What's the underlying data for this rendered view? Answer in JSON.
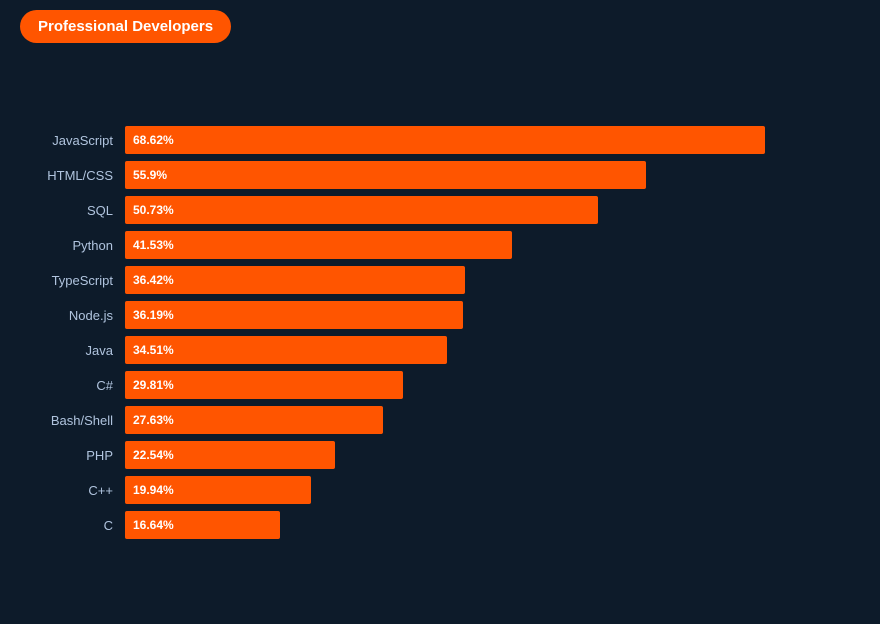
{
  "title": "Professional Developers",
  "colors": {
    "bg": "#0d1b2a",
    "bar": "#ff5500",
    "label": "#b0c4de",
    "text": "#ffffff",
    "badge_bg": "#ff5500"
  },
  "chart": {
    "max_percent": 68.62,
    "track_width": 640,
    "bars": [
      {
        "label": "JavaScript",
        "value": 68.62,
        "display": "68.62%"
      },
      {
        "label": "HTML/CSS",
        "value": 55.9,
        "display": "55.9%"
      },
      {
        "label": "SQL",
        "value": 50.73,
        "display": "50.73%"
      },
      {
        "label": "Python",
        "value": 41.53,
        "display": "41.53%"
      },
      {
        "label": "TypeScript",
        "value": 36.42,
        "display": "36.42%"
      },
      {
        "label": "Node.js",
        "value": 36.19,
        "display": "36.19%"
      },
      {
        "label": "Java",
        "value": 34.51,
        "display": "34.51%"
      },
      {
        "label": "C#",
        "value": 29.81,
        "display": "29.81%"
      },
      {
        "label": "Bash/Shell",
        "value": 27.63,
        "display": "27.63%"
      },
      {
        "label": "PHP",
        "value": 22.54,
        "display": "22.54%"
      },
      {
        "label": "C++",
        "value": 19.94,
        "display": "19.94%"
      },
      {
        "label": "C",
        "value": 16.64,
        "display": "16.64%"
      }
    ]
  }
}
